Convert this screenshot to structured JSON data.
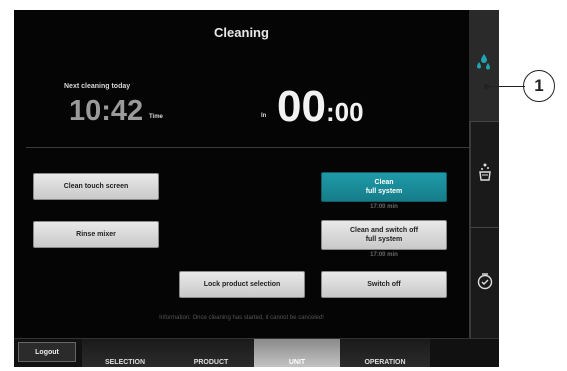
{
  "screen": {
    "title": "Cleaning",
    "next_cleaning_label": "Next cleaning today",
    "next_cleaning_time": "10:42",
    "time_unit": "Time",
    "in_label": "In",
    "countdown_hours": "00",
    "countdown_minutes": ":00",
    "info": "Information: Once cleaning has started, it cannot be canceled!"
  },
  "buttons": {
    "clean_touch_screen": "Clean touch screen",
    "rinse_mixer": "Rinse mixer",
    "lock_product_selection": "Lock product selection",
    "clean_full_system": "Clean\nfull system",
    "clean_full_system_duration": "17:00 min",
    "clean_switch_off_full_system": "Clean and switch off\nfull system",
    "clean_switch_off_duration": "17:00 min",
    "switch_off": "Switch off"
  },
  "sidebar": {
    "items": [
      {
        "icon": "water-drops-icon",
        "active": true
      },
      {
        "icon": "cleaning-cup-icon",
        "active": false
      },
      {
        "icon": "timer-check-icon",
        "active": false
      }
    ]
  },
  "nav": {
    "logout": "Logout",
    "tabs": [
      {
        "label": "SELECTION",
        "active": false
      },
      {
        "label": "PRODUCT",
        "active": false
      },
      {
        "label": "UNIT",
        "active": true
      },
      {
        "label": "OPERATION",
        "active": false
      }
    ]
  },
  "callout": {
    "number": "1"
  },
  "colors": {
    "accent": "#1a8e9b",
    "background": "#000000"
  }
}
